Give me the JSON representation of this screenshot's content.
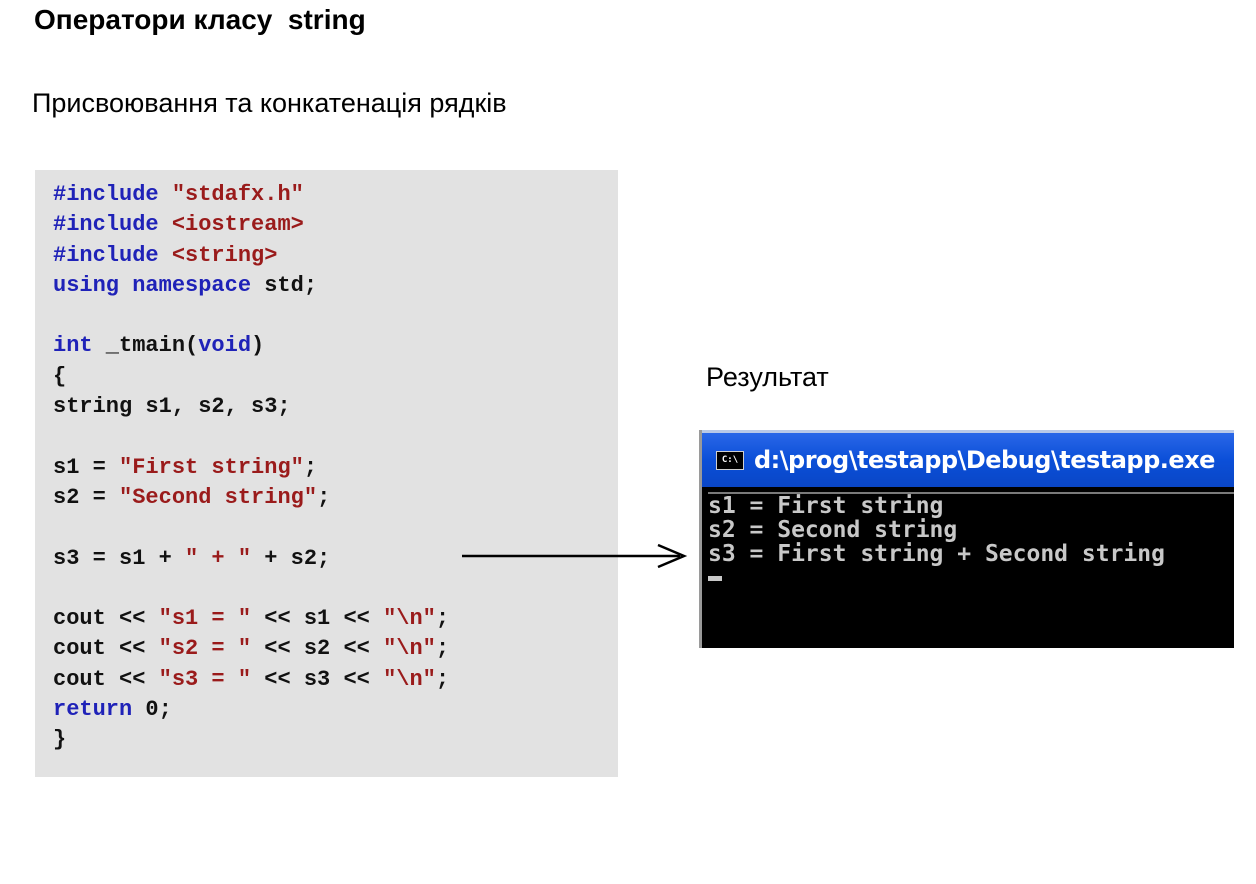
{
  "slide": {
    "title": "Оператори класу  string",
    "subtitle": "Присвоювання та конкатенація рядків",
    "result_label": "Результат"
  },
  "code": {
    "lines": [
      [
        {
          "t": "#include ",
          "c": "kw"
        },
        {
          "t": "\"stdafx.h\"",
          "c": "str"
        }
      ],
      [
        {
          "t": "#include ",
          "c": "kw"
        },
        {
          "t": "<iostream>",
          "c": "str"
        }
      ],
      [
        {
          "t": "#include ",
          "c": "kw"
        },
        {
          "t": "<string>",
          "c": "str"
        }
      ],
      [
        {
          "t": "using namespace ",
          "c": "kw"
        },
        {
          "t": "std;",
          "c": "plain"
        }
      ],
      [],
      [
        {
          "t": "int",
          "c": "kw"
        },
        {
          "t": " _tmain(",
          "c": "plain"
        },
        {
          "t": "void",
          "c": "kw"
        },
        {
          "t": ")",
          "c": "plain"
        }
      ],
      [
        {
          "t": "{",
          "c": "plain"
        }
      ],
      [
        {
          "t": "string s1, s2, s3;",
          "c": "plain"
        }
      ],
      [],
      [
        {
          "t": "s1 = ",
          "c": "plain"
        },
        {
          "t": "\"First string\"",
          "c": "str"
        },
        {
          "t": ";",
          "c": "plain"
        }
      ],
      [
        {
          "t": "s2 = ",
          "c": "plain"
        },
        {
          "t": "\"Second string\"",
          "c": "str"
        },
        {
          "t": ";",
          "c": "plain"
        }
      ],
      [],
      [
        {
          "t": "s3 = s1 + ",
          "c": "plain"
        },
        {
          "t": "\" + \"",
          "c": "str"
        },
        {
          "t": " + s2;",
          "c": "plain"
        }
      ],
      [],
      [
        {
          "t": "cout << ",
          "c": "plain"
        },
        {
          "t": "\"s1 = \"",
          "c": "str"
        },
        {
          "t": " << s1 << ",
          "c": "plain"
        },
        {
          "t": "\"\\n\"",
          "c": "str"
        },
        {
          "t": ";",
          "c": "plain"
        }
      ],
      [
        {
          "t": "cout << ",
          "c": "plain"
        },
        {
          "t": "\"s2 = \"",
          "c": "str"
        },
        {
          "t": " << s2 << ",
          "c": "plain"
        },
        {
          "t": "\"\\n\"",
          "c": "str"
        },
        {
          "t": ";",
          "c": "plain"
        }
      ],
      [
        {
          "t": "cout << ",
          "c": "plain"
        },
        {
          "t": "\"s3 = \"",
          "c": "str"
        },
        {
          "t": " << s3 << ",
          "c": "plain"
        },
        {
          "t": "\"\\n\"",
          "c": "str"
        },
        {
          "t": ";",
          "c": "plain"
        }
      ],
      [
        {
          "t": "return ",
          "c": "kw"
        },
        {
          "t": "0;",
          "c": "plain"
        }
      ],
      [
        {
          "t": "}",
          "c": "plain"
        }
      ]
    ]
  },
  "console": {
    "icon_text": "C:\\",
    "title": "d:\\prog\\testapp\\Debug\\testapp.exe",
    "output_lines": [
      "s1 = First string",
      "s2 = Second string",
      "s3 = First string + Second string"
    ]
  },
  "colors": {
    "keyword": "#1f22b8",
    "string": "#9a1b1b",
    "code_background": "#e2e2e2",
    "titlebar": "#0b4fd8"
  }
}
